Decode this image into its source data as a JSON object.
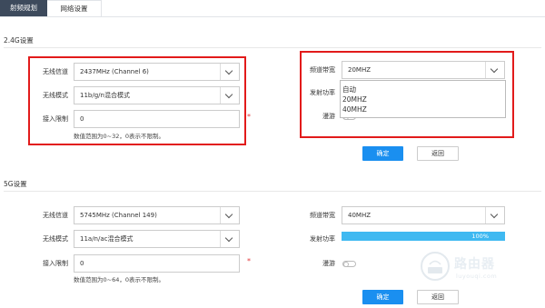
{
  "tabs": [
    {
      "label": "射频规划",
      "active": true
    },
    {
      "label": "网络设置",
      "active": false
    }
  ],
  "band24": {
    "title": "2.4G设置",
    "channel_label": "无线信道",
    "channel_value": "2437MHz (Channel 6)",
    "mode_label": "无线模式",
    "mode_value": "11b/g/n混合模式",
    "limit_label": "接入限制",
    "limit_value": "0",
    "limit_hint": "数值范围为0~32，0表示不限制。",
    "required_mark": "*",
    "bandwidth_label": "频道带宽",
    "bandwidth_value": "20MHZ",
    "power_label": "发射功率",
    "roam_label": "漫游",
    "bandwidth_options": [
      "自动",
      "20MHZ",
      "40MHZ"
    ],
    "confirm_label": "确定",
    "back_label": "返回"
  },
  "band5": {
    "title": "5G设置",
    "channel_label": "无线信道",
    "channel_value": "5745MHz (Channel 149)",
    "mode_label": "无线模式",
    "mode_value": "11a/n/ac混合模式",
    "limit_label": "接入限制",
    "limit_value": "0",
    "limit_hint": "数值范围为0~64，0表示不限制。",
    "required_mark": "*",
    "bandwidth_label": "频道带宽",
    "bandwidth_value": "40MHZ",
    "power_label": "发射功率",
    "power_percent": 100,
    "power_text": "100%",
    "roam_label": "漫游",
    "confirm_label": "确定",
    "back_label": "返回"
  },
  "watermark": {
    "title": "路由器",
    "subtitle": "luyouqi.com"
  },
  "colors": {
    "tab_active": "#3d4a5c",
    "primary": "#1a8ff0",
    "progress": "#3fb9f1",
    "highlight": "#e21b1b"
  },
  "icons": [
    "chevron-down-icon",
    "toggle-switch",
    "router-logo-icon"
  ]
}
